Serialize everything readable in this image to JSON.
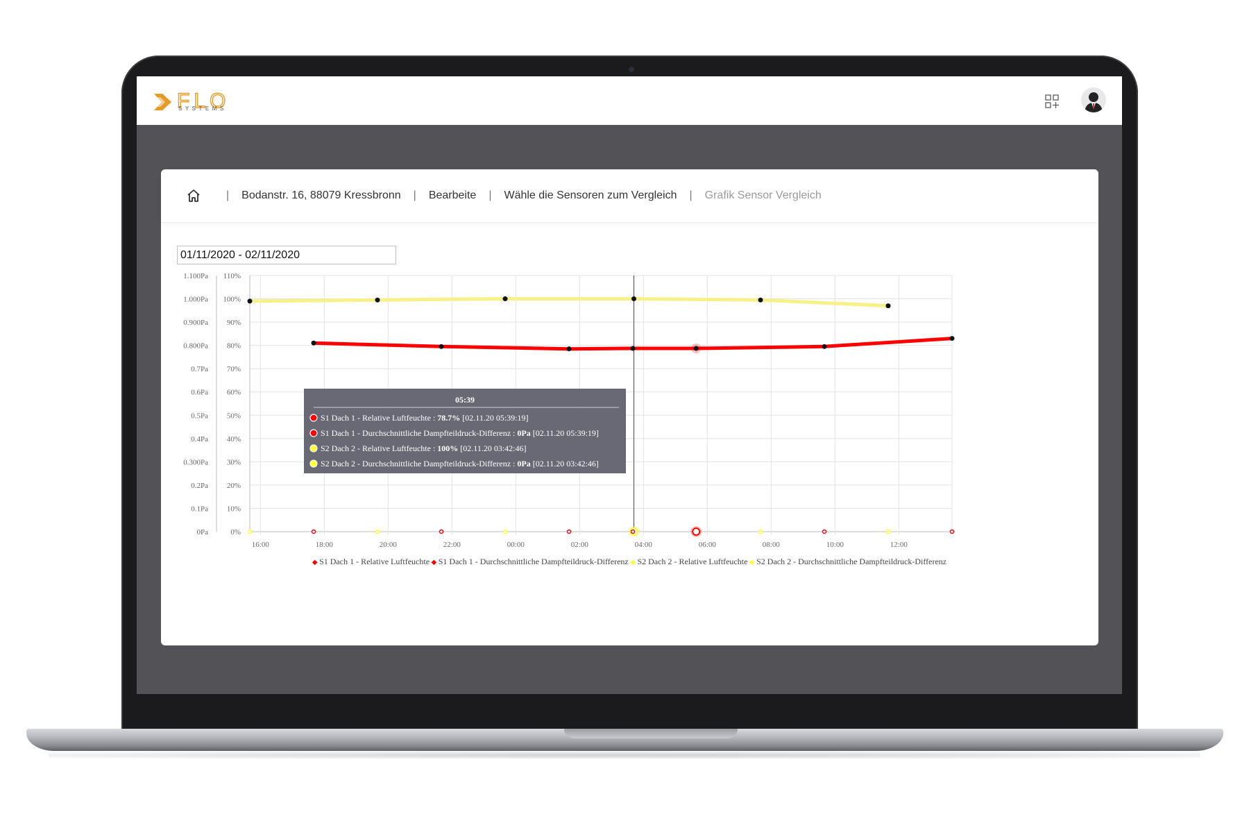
{
  "header": {
    "logo_text": "FLO",
    "logo_sub": "SYSTEMS",
    "brand_color": "#e79a24"
  },
  "breadcrumb": {
    "home_icon": "home-icon",
    "items": [
      {
        "label": "Bodanstr. 16, 88079 Kressbronn"
      },
      {
        "label": "Bearbeite"
      },
      {
        "label": "Wähle die Sensoren zum Vergleich"
      },
      {
        "label": "Grafik Sensor Vergleich"
      }
    ],
    "separator": "|"
  },
  "date_range": {
    "value": "01/11/2020 - 02/11/2020"
  },
  "chart_data": {
    "type": "line",
    "x_ticks": [
      "16:00",
      "18:00",
      "20:00",
      "22:00",
      "00:00",
      "02:00",
      "04:00",
      "06:00",
      "08:00",
      "10:00",
      "12:00"
    ],
    "y_left_ticks": [
      "0Pa",
      "0.1Pa",
      "0.2Pa",
      "0.300Pa",
      "0.4Pa",
      "0.5Pa",
      "0.6Pa",
      "0.7Pa",
      "0.800Pa",
      "0.900Pa",
      "1.000Pa",
      "1.100Pa"
    ],
    "y_right_ticks": [
      "0%",
      "10%",
      "20%",
      "30%",
      "40%",
      "50%",
      "60%",
      "70%",
      "80%",
      "90%",
      "100%",
      "110%"
    ],
    "ylim_pct": [
      0,
      110
    ],
    "ylim_pa": [
      0,
      1.1
    ],
    "grid": true,
    "legend_position": "bottom",
    "series": [
      {
        "name": "S1 Dach 1 - Relative Luftfeuchte",
        "color": "#ff0000",
        "axis": "pct",
        "x": [
          "17:40",
          "21:40",
          "01:40",
          "03:40",
          "05:39",
          "09:40",
          "13:40"
        ],
        "values": [
          81,
          79.5,
          78.5,
          78.7,
          78.7,
          79.5,
          83
        ]
      },
      {
        "name": "S1 Dach 1 - Durchschnittliche Dampfteildruck-Differenz",
        "color": "#ff0000",
        "axis": "pa",
        "x": [
          "17:40",
          "21:40",
          "01:40",
          "03:40",
          "05:39",
          "09:40",
          "13:40"
        ],
        "values": [
          0,
          0,
          0,
          0,
          0,
          0,
          0
        ]
      },
      {
        "name": "S2 Dach 2 - Relative Luftfeuchte",
        "color": "#f7f189",
        "axis": "pct",
        "x": [
          "15:40",
          "19:40",
          "23:40",
          "03:42",
          "07:40",
          "11:40"
        ],
        "values": [
          99,
          99.5,
          100,
          100,
          99.5,
          97
        ]
      },
      {
        "name": "S2 Dach 2 - Durchschnittliche Dampfteildruck-Differenz",
        "color": "#ffff33",
        "axis": "pa",
        "x": [
          "15:40",
          "19:40",
          "23:40",
          "03:42",
          "07:40",
          "11:40"
        ],
        "values": [
          0,
          0,
          0,
          0,
          0,
          0
        ]
      }
    ],
    "tooltip": {
      "title": "05:39",
      "rows": [
        {
          "color": "#ff0000",
          "label": "S1 Dach 1 - Relative Luftfeuchte : ",
          "value": "78.7%",
          "stamp": " [02.11.20 05:39:19]"
        },
        {
          "color": "#ff0000",
          "label": "S1 Dach 1 - Durchschnittliche Dampfteildruck-Differenz : ",
          "value": "0Pa",
          "stamp": " [02.11.20 05:39:19]"
        },
        {
          "color": "#ffff33",
          "label": "S2 Dach 2 - Relative Luftfeuchte : ",
          "value": "100%",
          "stamp": " [02.11.20 03:42:46]"
        },
        {
          "color": "#ffff33",
          "label": "S2 Dach 2 - Durchschnittliche Dampfteildruck-Differenz : ",
          "value": "0Pa",
          "stamp": " [02.11.20 03:42:46]"
        }
      ]
    }
  }
}
